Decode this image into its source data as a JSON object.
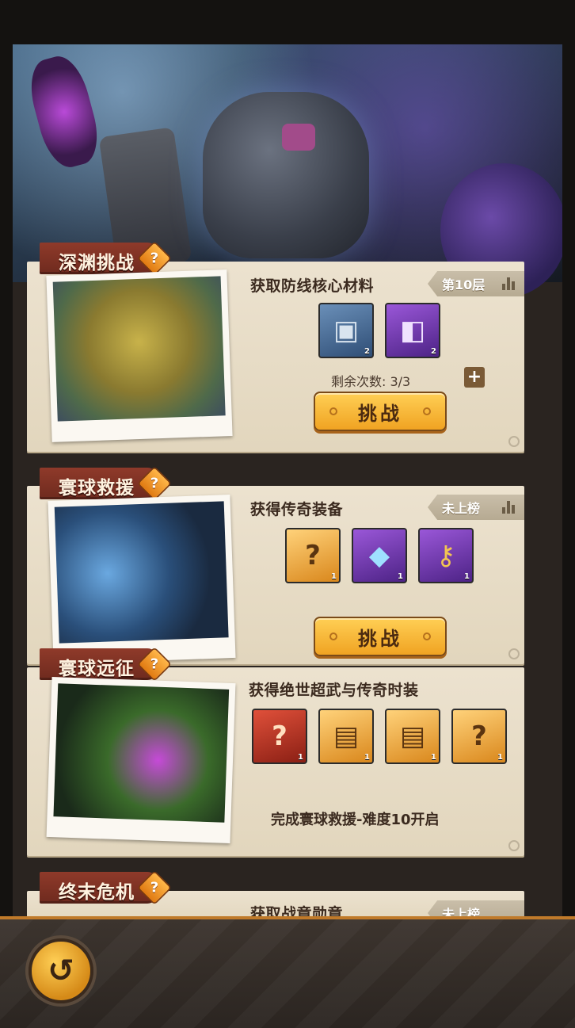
{
  "sections": [
    {
      "tag": "深渊挑战",
      "subtitle": "获取防线核心材料",
      "rank": "第10层",
      "rewards": [
        {
          "icon": "ore-crate-icon",
          "count": "2"
        },
        {
          "icon": "purple-chip-icon",
          "count": "2"
        }
      ],
      "remaining": "剩余次数: 3/3",
      "button": "挑战"
    },
    {
      "tag": "寰球救援",
      "subtitle": "获得传奇装备",
      "rank": "未上榜",
      "rewards": [
        {
          "icon": "mystery-chest-icon",
          "count": "1"
        },
        {
          "icon": "diamond-icon",
          "count": "1"
        },
        {
          "icon": "key-icon",
          "count": "1"
        }
      ],
      "button": "挑战"
    },
    {
      "tag": "寰球远征",
      "subtitle": "获得绝世超武与传奇时装",
      "rewards": [
        {
          "icon": "mystery-robot-chest-icon",
          "count": "1"
        },
        {
          "icon": "gold-chest-a-icon",
          "count": "1"
        },
        {
          "icon": "gold-chest-b-icon",
          "count": "1"
        },
        {
          "icon": "mystery-chest-icon",
          "count": "1"
        }
      ],
      "unlock": "完成寰球救援-难度10开启"
    },
    {
      "tag": "终末危机",
      "subtitle": "获取战章勋章",
      "rank": "未上榜"
    }
  ],
  "question_mark": "?",
  "plus": "+"
}
